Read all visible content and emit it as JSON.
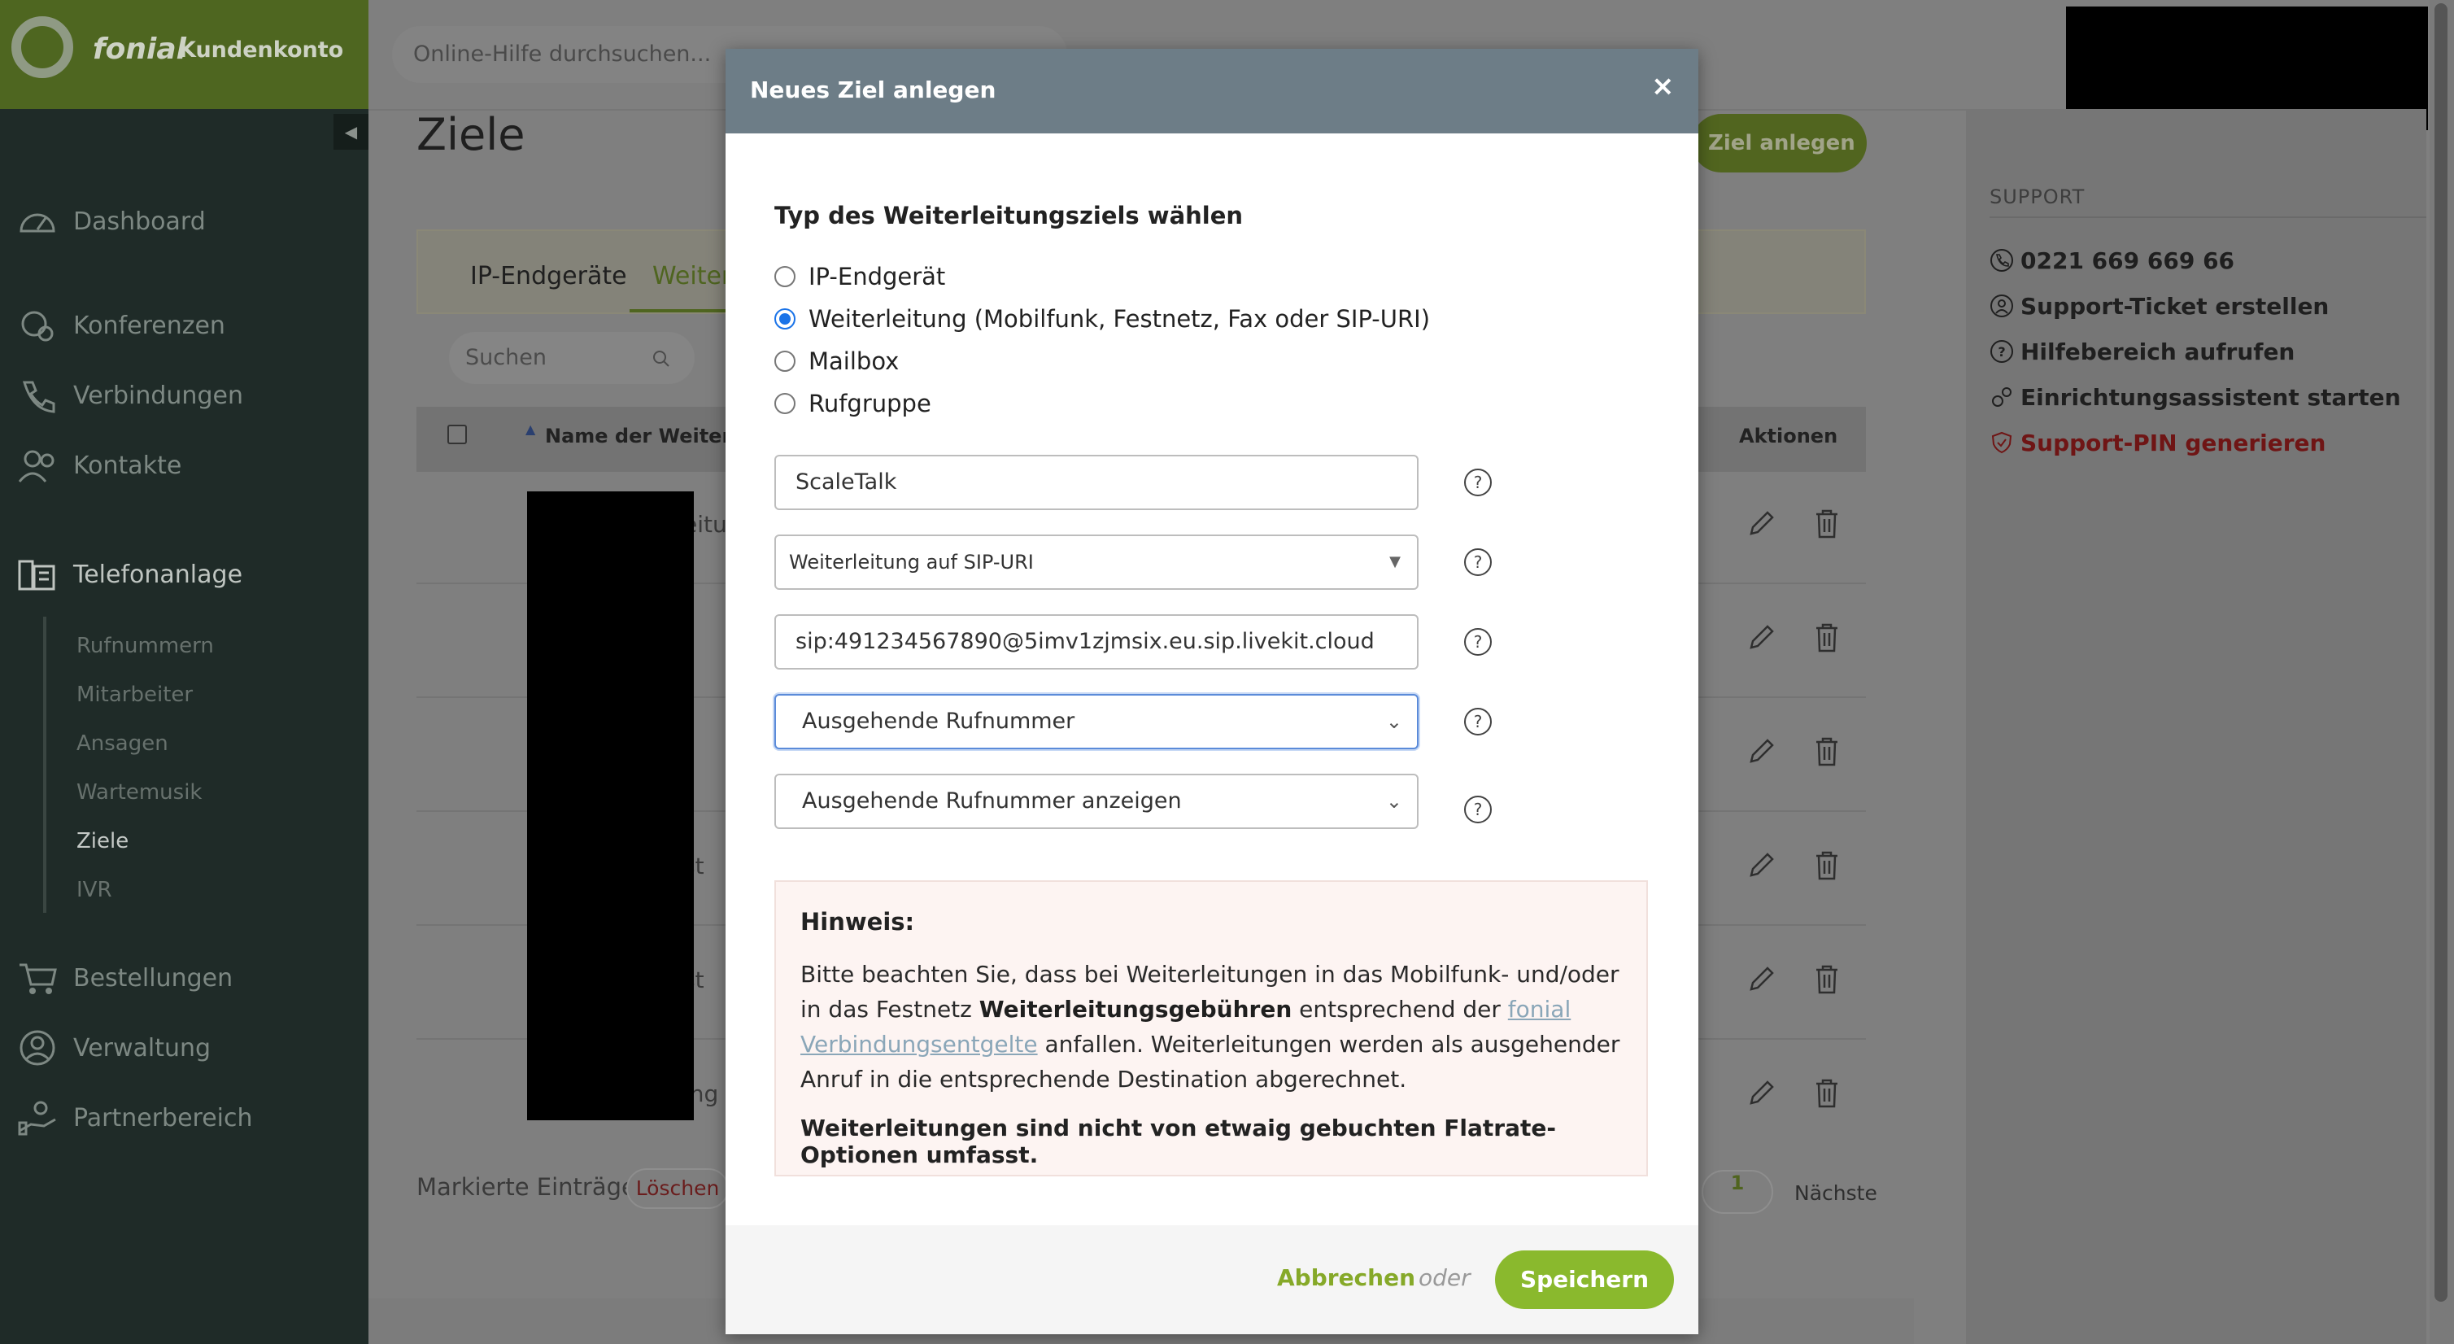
{
  "brand": {
    "name": "fonial",
    "subtitle": "Kundenkonto"
  },
  "topbar": {
    "search_placeholder": "Online-Hilfe durchsuchen..."
  },
  "sidebar": {
    "items": [
      {
        "label": "Dashboard",
        "icon": "speedometer-icon"
      },
      {
        "label": "Konferenzen",
        "icon": "conference-icon"
      },
      {
        "label": "Verbindungen",
        "icon": "phone-icon"
      },
      {
        "label": "Kontakte",
        "icon": "contacts-icon"
      },
      {
        "label": "Telefonanlage",
        "icon": "pbx-icon"
      },
      {
        "label": "Bestellungen",
        "icon": "cart-icon"
      },
      {
        "label": "Verwaltung",
        "icon": "user-icon"
      },
      {
        "label": "Partnerbereich",
        "icon": "partner-icon"
      }
    ],
    "subitems": [
      "Rufnummern",
      "Mitarbeiter",
      "Ansagen",
      "Wartemusik",
      "Ziele",
      "IVR"
    ],
    "active_sub": "Ziele"
  },
  "main": {
    "title": "Ziele",
    "new_button": "Ziel anlegen",
    "tabs": [
      "IP-Endgeräte",
      "Weiterl"
    ],
    "search_placeholder": "Suchen",
    "columns": {
      "name": "Name der Weiterleit",
      "actions": "Aktionen"
    },
    "row_fragments": [
      "eitu",
      "st",
      "st",
      "ing"
    ],
    "marked_label": "Markierte Einträge",
    "delete_label": "Löschen",
    "page": "1",
    "next_label": "Nächste"
  },
  "support": {
    "title": "SUPPORT",
    "items": [
      {
        "label": "0221 669 669 66",
        "icon": "phone-icon"
      },
      {
        "label": "Support-Ticket erstellen",
        "icon": "ticket-icon"
      },
      {
        "label": "Hilfebereich aufrufen",
        "icon": "help-icon"
      },
      {
        "label": "Einrichtungsassistent starten",
        "icon": "gears-icon"
      },
      {
        "label": "Support-PIN generieren",
        "icon": "shield-icon",
        "color": "#c0392b"
      }
    ]
  },
  "modal": {
    "title": "Neues Ziel anlegen",
    "close": "×",
    "type_heading": "Typ des Weiterleitungsziels wählen",
    "radios": [
      {
        "label": "IP-Endgerät",
        "checked": false
      },
      {
        "label": "Weiterleitung (Mobilfunk, Festnetz, Fax oder SIP-URI)",
        "checked": true
      },
      {
        "label": "Mailbox",
        "checked": false
      },
      {
        "label": "Rufgruppe",
        "checked": false
      }
    ],
    "name_value": "ScaleTalk",
    "forward_type": "Weiterleitung auf SIP-URI",
    "sip_uri": "sip:491234567890@5imv1zjmsix.eu.sip.livekit.cloud",
    "outgoing_number": "Ausgehende Rufnummer",
    "show_number": "Ausgehende Rufnummer anzeigen",
    "hint": {
      "title": "Hinweis:",
      "text1": "Bitte beachten Sie, dass bei Weiterleitungen in das Mobilfunk- und/oder in das Festnetz ",
      "bold": "Weiterleitungsgebühren",
      "text2": " entsprechend der ",
      "link": "fonial Verbindungsentgelte",
      "text3": " anfallen. Weiterleitungen werden als ausgehender Anruf in die entsprechende Destination abgerechnet.",
      "note": "Weiterleitungen sind nicht von etwaig gebuchten Flatrate-Optionen umfasst."
    },
    "cancel_label": "Abbrechen",
    "or_label": "oder",
    "save_label": "Speichern"
  },
  "colors": {
    "brand_green": "#8ab92d",
    "header_slate": "#6d7d87",
    "danger": "#c0392b"
  }
}
